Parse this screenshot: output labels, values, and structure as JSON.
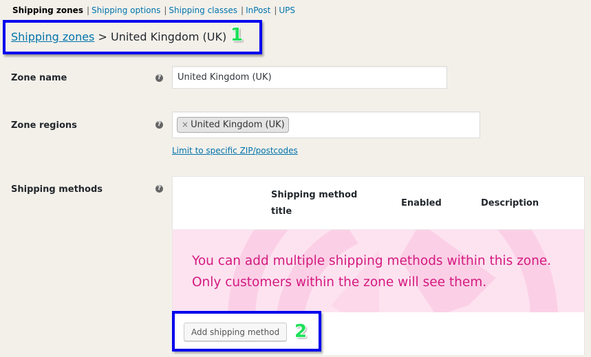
{
  "subnav": {
    "items": [
      {
        "label": "Shipping zones",
        "current": true
      },
      {
        "label": "Shipping options",
        "current": false
      },
      {
        "label": "Shipping classes",
        "current": false
      },
      {
        "label": "InPost",
        "current": false
      },
      {
        "label": "UPS",
        "current": false
      }
    ],
    "separator": "|"
  },
  "breadcrumb": {
    "link": "Shipping zones",
    "separator": ">",
    "current": "United Kingdom (UK)"
  },
  "callouts": {
    "one": "1",
    "two": "2"
  },
  "form": {
    "zone_name": {
      "label": "Zone name",
      "help": "?",
      "value": "United Kingdom (UK)"
    },
    "zone_regions": {
      "label": "Zone regions",
      "help": "?",
      "chips": [
        {
          "remove": "×",
          "label": "United Kingdom (UK)"
        }
      ],
      "limit_link": "Limit to specific ZIP/postcodes"
    },
    "shipping_methods": {
      "label": "Shipping methods",
      "help": "?",
      "columns": [
        "Shipping method title",
        "Enabled",
        "Description"
      ],
      "blank_state": {
        "line1": "You can add multiple shipping methods within this zone.",
        "line2": "Only customers within the zone will see them."
      },
      "add_button": "Add shipping method"
    }
  },
  "colors": {
    "link": "#0073aa",
    "callout_border": "#0000ee",
    "callout_number": "#1fe05a",
    "blank_state_bg": "#fde3f0",
    "blank_state_text": "#d4197f"
  }
}
